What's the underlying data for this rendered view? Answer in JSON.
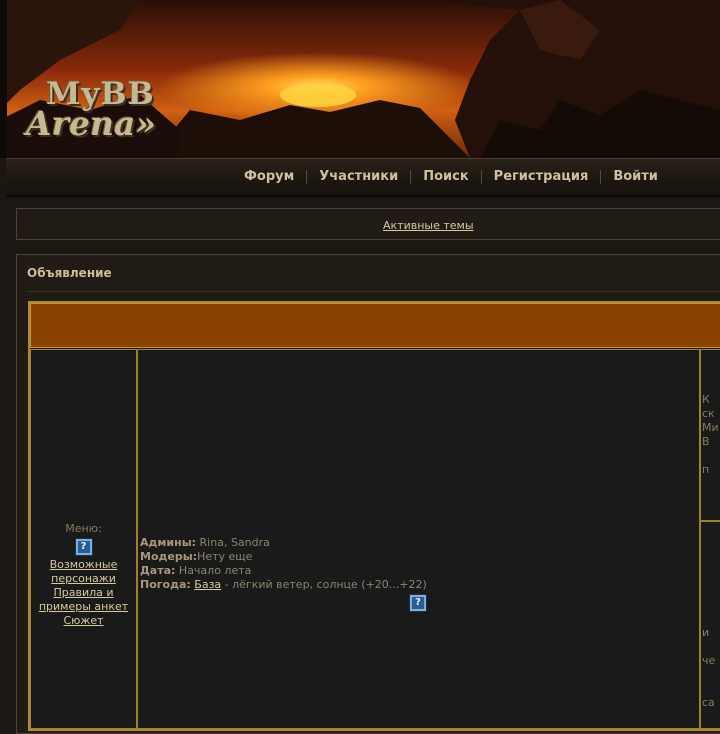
{
  "banner": {
    "logo_line1": "MyBB",
    "logo_line2": "Arena»"
  },
  "nav": {
    "items": [
      "Форум",
      "Участники",
      "Поиск",
      "Регистрация",
      "Войти"
    ]
  },
  "active_topics": "Активные темы",
  "announcement": {
    "heading": "Объявление",
    "menu": {
      "title": "Меню:",
      "links": [
        "Возможные персонажи",
        "Правила и примеры анкет",
        "Сюжет"
      ]
    },
    "info": {
      "admins_label": "Админы:",
      "admins_value": " Rina, Sandra",
      "mods_label": "Модеры:",
      "mods_value": "Нету еще",
      "date_label": "Дата:",
      "date_value": " Начало лета",
      "weather_label": "Погода:",
      "weather_link": "База",
      "weather_value": " - лёгкий ветер, солнце (+20...+22)"
    },
    "cut_text": [
      "К",
      "ск",
      "Ми",
      "В",
      "п",
      "и",
      "че",
      "са"
    ]
  },
  "icons": {
    "help": "help-icon"
  },
  "colors": {
    "accent_orange": "#8a4200",
    "frame_gold": "#b08a2a",
    "link": "#d8c8a0"
  }
}
